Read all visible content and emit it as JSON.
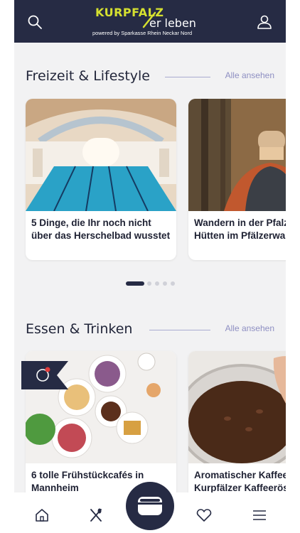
{
  "header": {
    "logo_top": "KURPFALZ",
    "logo_bottom": "er  leben",
    "logo_sub": "powered by Sparkasse Rhein Neckar Nord",
    "search_icon": "search-icon",
    "profile_icon": "user-icon"
  },
  "sections": [
    {
      "title": "Freizeit & Lifestyle",
      "link": "Alle ansehen",
      "cards": [
        {
          "caption": "5 Dinge, die Ihr noch nicht über das Herschelbad wusstet",
          "image": "indoor-swimming-pool-photo"
        },
        {
          "caption": "Wandern in der Pfalz: schöne Hütten im Pfälzerwald",
          "image": "hiker-forest-photo"
        }
      ]
    },
    {
      "title": "Essen & Trinken",
      "link": "Alle ansehen",
      "cards": [
        {
          "caption": "6 tolle Frühstückcafés in Mannheim",
          "image": "breakfast-table-photo"
        },
        {
          "caption": "Aromatischer Kaffee: Kurpfälzer Kaffeerösterei",
          "image": "coffee-beans-photo"
        }
      ]
    }
  ],
  "carousel": {
    "active_index": 0,
    "count": 5
  },
  "bottom_nav": {
    "items": [
      {
        "icon": "home-icon"
      },
      {
        "icon": "cutlery-icon"
      },
      {
        "icon": "wallet-icon"
      },
      {
        "icon": "heart-icon"
      },
      {
        "icon": "menu-icon"
      }
    ]
  },
  "colors": {
    "header_bg": "#262b44",
    "accent": "#d5e030",
    "link": "#8e8fc2",
    "background": "#f2f2f3"
  }
}
